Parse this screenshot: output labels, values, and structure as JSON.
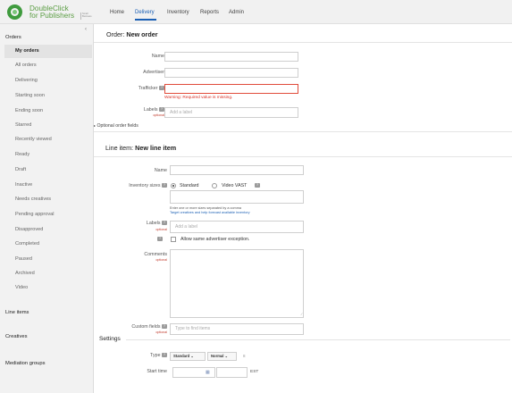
{
  "app": {
    "logo_line1": "DoubleClick",
    "logo_line2": "for Publishers",
    "logo_tag": "Small Business",
    "brand_color": "#3f9b3e",
    "accent_color": "#1a5fb4",
    "error_color": "#d93025"
  },
  "nav": {
    "items": [
      "Home",
      "Delivery",
      "Inventory",
      "Reports",
      "Admin"
    ],
    "active": "Delivery"
  },
  "sidebar": {
    "collapse_icon": "chevron-left-icon",
    "orders_header": "Orders",
    "items": [
      "My orders",
      "All orders",
      "Delivering",
      "Starting soon",
      "Ending soon",
      "Starred",
      "Recently viewed",
      "Ready",
      "Draft",
      "Inactive",
      "Needs creatives",
      "Pending approval",
      "Disapproved",
      "Completed",
      "Paused",
      "Archived",
      "Video"
    ],
    "selected": "My orders",
    "sections": [
      "Line items",
      "Creatives",
      "Mediation groups"
    ]
  },
  "order": {
    "title_prefix": "Order:",
    "title": "New order",
    "name_label": "Name",
    "name_value": "",
    "advertiser_label": "Advertiser",
    "advertiser_value": "",
    "trafficker_label": "Trafficker",
    "trafficker_value": "",
    "trafficker_warning": "Warning: Required value is missing.",
    "labels_label": "Labels",
    "labels_optional": "optional",
    "labels_placeholder": "Add a label",
    "optional_fields": "Optional order fields"
  },
  "line_item": {
    "title_prefix": "Line item:",
    "title": "New line item",
    "name_label": "Name",
    "name_value": "",
    "inventory_sizes_label": "Inventory sizes",
    "size_options": [
      "Standard",
      "Video VAST"
    ],
    "size_selected": "Standard",
    "sizes_value": "",
    "sizes_hint": "Enter one or more sizes separated by a comma",
    "sizes_link": "Target creatives and help forecast available inventory",
    "labels_label": "Labels",
    "labels_optional": "optional",
    "labels_placeholder": "Add a label",
    "allow_exception_label": "Allow same advertiser exception.",
    "allow_exception_checked": false,
    "comments_label": "Comments",
    "comments_optional": "optional",
    "comments_value": "",
    "custom_fields_label": "Custom fields",
    "custom_fields_optional": "optional",
    "custom_fields_placeholder": "Type to find items"
  },
  "settings": {
    "title": "Settings",
    "type_label": "Type",
    "type_value": "Standard",
    "priority_value": "Normal",
    "priority_number": "8",
    "start_time_label": "Start time",
    "timezone": "EST"
  }
}
